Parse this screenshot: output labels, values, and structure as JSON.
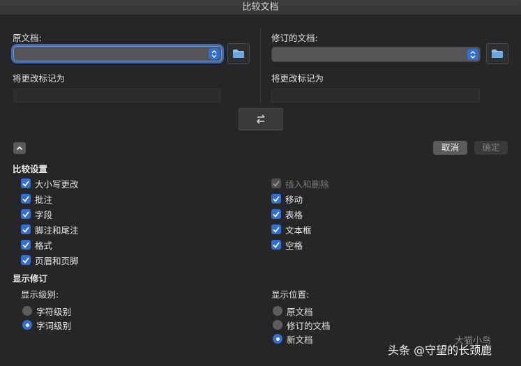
{
  "window": {
    "title": "比较文档"
  },
  "original": {
    "label": "原文档:",
    "value": "",
    "mark_label": "将更改标记为",
    "mark_value": ""
  },
  "revised": {
    "label": "修订的文档:",
    "value": "",
    "mark_label": "将更改标记为",
    "mark_value": ""
  },
  "buttons": {
    "cancel": "取消",
    "ok": "确定"
  },
  "compare_settings": {
    "title": "比较设置",
    "left": [
      {
        "label": "大小写更改",
        "checked": true
      },
      {
        "label": "批注",
        "checked": true
      },
      {
        "label": "字段",
        "checked": true
      },
      {
        "label": "脚注和尾注",
        "checked": true
      },
      {
        "label": "格式",
        "checked": true
      },
      {
        "label": "页眉和页脚",
        "checked": true
      }
    ],
    "right": [
      {
        "label": "插入和删除",
        "checked": true,
        "disabled": true
      },
      {
        "label": "移动",
        "checked": true
      },
      {
        "label": "表格",
        "checked": true
      },
      {
        "label": "文本框",
        "checked": true
      },
      {
        "label": "空格",
        "checked": true
      }
    ]
  },
  "show_revisions": {
    "title": "显示修订",
    "level_label": "显示级别:",
    "levels": [
      {
        "label": "字符级别",
        "selected": false
      },
      {
        "label": "字词级别",
        "selected": true
      }
    ],
    "position_label": "显示位置:",
    "positions": [
      {
        "label": "原文档",
        "selected": false
      },
      {
        "label": "修订的文档",
        "selected": false
      },
      {
        "label": "新文档",
        "selected": true
      }
    ]
  },
  "watermark": {
    "text": "头条 @守望的长颈鹿",
    "faint": "大猫小鸟"
  },
  "colors": {
    "accent": "#2f6fd6",
    "background": "#262628"
  }
}
